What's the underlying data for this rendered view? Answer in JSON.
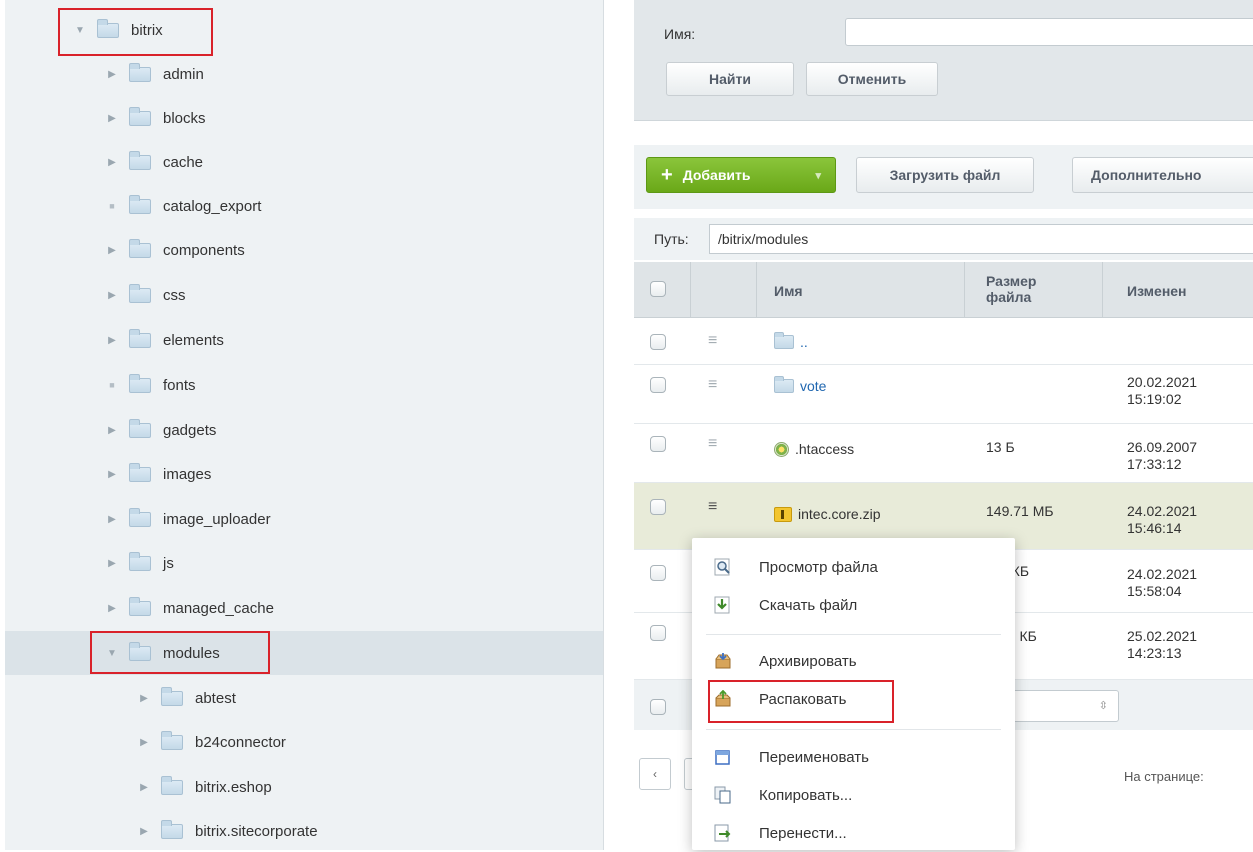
{
  "tree": {
    "items": [
      {
        "label": "bitrix",
        "expanded": true,
        "level": 0
      },
      {
        "label": "admin",
        "level": 1
      },
      {
        "label": "blocks",
        "level": 1
      },
      {
        "label": "cache",
        "level": 1
      },
      {
        "label": "catalog_export",
        "level": 1,
        "leaf": true
      },
      {
        "label": "components",
        "level": 1
      },
      {
        "label": "css",
        "level": 1
      },
      {
        "label": "elements",
        "level": 1
      },
      {
        "label": "fonts",
        "level": 1,
        "leaf": true
      },
      {
        "label": "gadgets",
        "level": 1
      },
      {
        "label": "images",
        "level": 1
      },
      {
        "label": "image_uploader",
        "level": 1
      },
      {
        "label": "js",
        "level": 1
      },
      {
        "label": "managed_cache",
        "level": 1
      },
      {
        "label": "modules",
        "level": 1,
        "expanded": true,
        "active": true
      },
      {
        "label": "abtest",
        "level": 2
      },
      {
        "label": "b24connector",
        "level": 2
      },
      {
        "label": "bitrix.eshop",
        "level": 2
      },
      {
        "label": "bitrix.sitecorporate",
        "level": 2
      }
    ]
  },
  "filter": {
    "name_label": "Имя:",
    "find_button": "Найти",
    "cancel_button": "Отменить"
  },
  "toolbar": {
    "add_button": "Добавить",
    "upload_button": "Загрузить файл",
    "more_button": "Дополнительно"
  },
  "path": {
    "label": "Путь:",
    "value": "/bitrix/modules"
  },
  "grid": {
    "headers": {
      "name": "Имя",
      "size": "Размер файла",
      "modified": "Изменен"
    },
    "rows": [
      {
        "name": "..",
        "size": "",
        "date": "",
        "time": "",
        "icon": "folder-up-icon"
      },
      {
        "name": "vote",
        "size": "",
        "date": "20.02.2021",
        "time": "15:19:02",
        "icon": "folder-icon"
      },
      {
        "name": ".htaccess",
        "size": "13 Б",
        "date": "26.09.2007",
        "time": "17:33:12",
        "icon": "htaccess-file-icon"
      },
      {
        "name": "intec.core.zip",
        "size": "149.71 МБ",
        "date": "24.02.2021",
        "time": "15:46:14",
        "icon": "zip-file-icon",
        "highlighted": true
      },
      {
        "name": "",
        "size": "9 КБ",
        "date": "24.02.2021",
        "time": "15:58:04"
      },
      {
        "name": "",
        "size": "02 КБ",
        "date": "25.02.2021",
        "time": "14:23:13"
      }
    ]
  },
  "pager": {
    "prev_label": "‹",
    "per_page_label": "На странице:",
    "per_page_select_arrow": "⇳"
  },
  "context_menu": {
    "items": [
      {
        "label": "Просмотр файла",
        "icon": "magnifier-icon"
      },
      {
        "label": "Скачать файл",
        "icon": "download-icon"
      },
      {
        "label": "Архивировать",
        "icon": "archive-box-icon"
      },
      {
        "label": "Распаковать",
        "icon": "unpack-box-icon",
        "highlighted": true
      },
      {
        "label": "Переименовать",
        "icon": "rename-icon"
      },
      {
        "label": "Копировать...",
        "icon": "copy-icon"
      },
      {
        "label": "Перенести...",
        "icon": "move-icon"
      }
    ]
  },
  "colors": {
    "accent_green": "#6aa818",
    "highlight_red": "#d9222a",
    "row_highlight": "#e8ebd9"
  }
}
